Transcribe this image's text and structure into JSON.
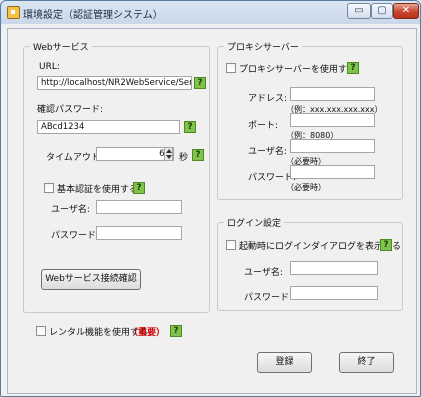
{
  "window": {
    "title": "環境設定（認証管理システム）",
    "controls": {
      "minimize": "▭",
      "maximize": "▢",
      "close": "✕"
    }
  },
  "web": {
    "group_label": "Webサービス",
    "url_label": "URL:",
    "url_value": "http://localhost/NR2WebService/Service",
    "confirm_pw_label": "確認パスワード:",
    "confirm_pw_value": "ABcd1234",
    "timeout_label": "タイムアウト:",
    "timeout_value": "60",
    "timeout_unit": "秒",
    "basic_auth_label": "基本認証を使用する",
    "username_label": "ユーザ名:",
    "password_label": "パスワード:",
    "test_button": "Webサービス接続確認"
  },
  "proxy": {
    "group_label": "プロキシサーバー",
    "use_label": "プロキシサーバーを使用する",
    "address_label": "アドレス:",
    "address_hint": "（例：xxx.xxx.xxx.xxx）",
    "port_label": "ポート:",
    "port_hint": "（例：8080）",
    "username_label": "ユーザ名:",
    "username_hint": "（必要時）",
    "password_label": "パスワード:",
    "password_hint": "（必要時）"
  },
  "login": {
    "group_label": "ログイン設定",
    "show_dialog_label": "起動時にログインダイアログを表示する",
    "username_label": "ユーザ名:",
    "password_label": "パスワード:"
  },
  "rental": {
    "label": "レンタル機能を使用する",
    "important": "（重要）"
  },
  "help_glyph": "?",
  "buttons": {
    "register": "登録",
    "exit": "終了"
  }
}
